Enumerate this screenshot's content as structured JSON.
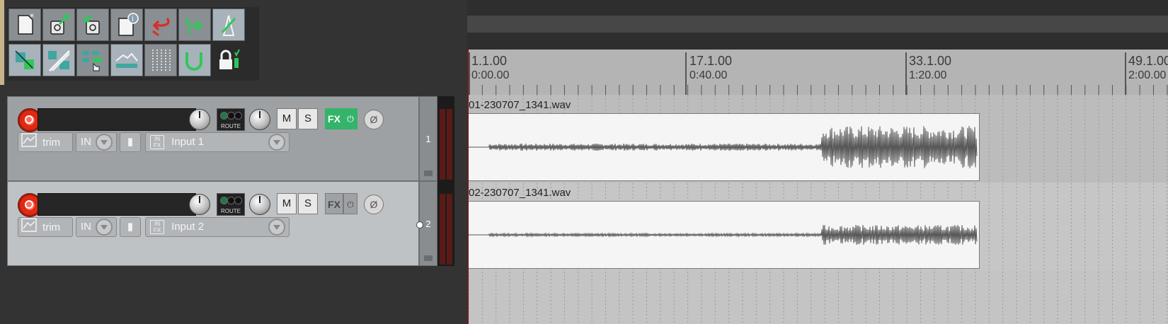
{
  "toolbar": {
    "row1": [
      {
        "name": "new-project-icon"
      },
      {
        "name": "open-project-icon"
      },
      {
        "name": "save-project-icon"
      },
      {
        "name": "project-settings-icon"
      },
      {
        "name": "undo-icon"
      },
      {
        "name": "redo-icon"
      },
      {
        "name": "metronome-icon"
      }
    ],
    "row2": [
      {
        "name": "snap-icon"
      },
      {
        "name": "ripple-edit-icon"
      },
      {
        "name": "item-grouping-icon"
      },
      {
        "name": "envelope-points-icon"
      },
      {
        "name": "grid-icon"
      },
      {
        "name": "loop-icon"
      },
      {
        "name": "lock-icon"
      }
    ]
  },
  "tracks": [
    {
      "number": "1",
      "route_label": "ROUTE",
      "mute_label": "M",
      "solo_label": "S",
      "fx_label": "FX",
      "fx_active": true,
      "phase_symbol": "Ø",
      "automation_label": "trim",
      "input_label": "IN",
      "input_name": "Input 1",
      "infx_top": "IN",
      "infx_bottom": "FX"
    },
    {
      "number": "2",
      "route_label": "ROUTE",
      "mute_label": "M",
      "solo_label": "S",
      "fx_label": "FX",
      "fx_active": false,
      "phase_symbol": "Ø",
      "automation_label": "trim",
      "input_label": "IN",
      "input_name": "Input 2",
      "infx_top": "IN",
      "infx_bottom": "FX"
    }
  ],
  "ruler": {
    "markers": [
      {
        "measure": "1.1.00",
        "time": "0:00.00"
      },
      {
        "measure": "17.1.00",
        "time": "0:40.00"
      },
      {
        "measure": "33.1.00",
        "time": "1:20.00"
      },
      {
        "measure": "49.1.00",
        "time": "2:00.00"
      }
    ]
  },
  "items": [
    {
      "name": "01-230707_1341.wav"
    },
    {
      "name": "02-230707_1341.wav"
    }
  ],
  "colors": {
    "fx_active": "#33b46a",
    "fx_inactive": "#9ea2a5",
    "record_arm": "#e02a14",
    "meter_bg": "#5a1a18"
  }
}
